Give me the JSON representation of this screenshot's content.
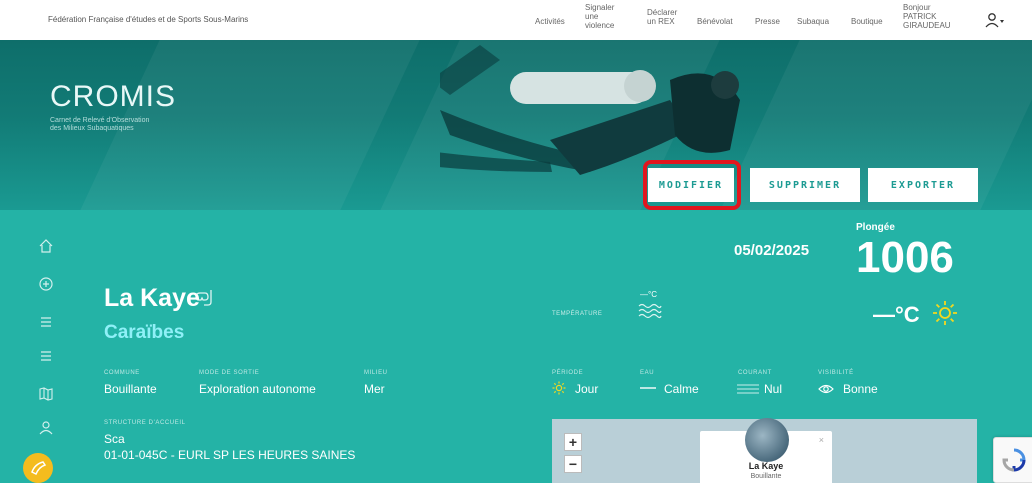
{
  "topbar": {
    "org_name": "Fédération Française d'études et de Sports Sous-Marins",
    "nav": {
      "activites": "Activités",
      "signaler": [
        "Signaler",
        "une",
        "violence"
      ],
      "declarer": [
        "Déclarer",
        "un REX"
      ],
      "benevolat": "Bénévolat",
      "presse": "Presse",
      "subaqua": "Subaqua",
      "boutique": "Boutique",
      "greeting": [
        "Bonjour",
        "PATRICK",
        "GIRAUDEAU"
      ]
    }
  },
  "logo": {
    "name": "CROMIS",
    "subtitle": [
      "Carnet de Relevé d'Observation",
      "des Milieux Subaquatiques"
    ]
  },
  "actions": {
    "modify": "MODIFIER",
    "delete": "SUPPRIMER",
    "export": "EXPORTER"
  },
  "dive": {
    "date": "05/02/2025",
    "plongee_label": "Plongée",
    "plongee_number": "1006",
    "site_name": "La Kaye",
    "region": "Caraïbes",
    "temperature_label": "TEMPÉRATURE",
    "temperature_small": "—°C",
    "temperature_big": "—°C"
  },
  "fields": {
    "commune_label": "COMMUNE",
    "commune_value": "Bouillante",
    "mode_label": "MODE DE SORTIE",
    "mode_value": "Exploration autonome",
    "milieu_label": "MILIEU",
    "milieu_value": "Mer",
    "periode_label": "PÉRIODE",
    "periode_value": "Jour",
    "eau_label": "EAU",
    "eau_value": "Calme",
    "courant_label": "COURANT",
    "courant_value": "Nul",
    "visibilite_label": "VISIBILITÉ",
    "visibilite_value": "Bonne",
    "structure_label": "STRUCTURE D'ACCUEIL",
    "structure_value_1": "Sca",
    "structure_value_2": "01-01-045C - EURL SP LES HEURES SAINES"
  },
  "map": {
    "zoom_in": "+",
    "zoom_out": "−",
    "popup_name": "La Kaye",
    "popup_city": "Bouillante",
    "popup_close": "×"
  },
  "colors": {
    "teal": "#24b3a6",
    "region": "#8ff0f7",
    "highlight": "#e1161e",
    "fab": "#f4bc1e"
  }
}
